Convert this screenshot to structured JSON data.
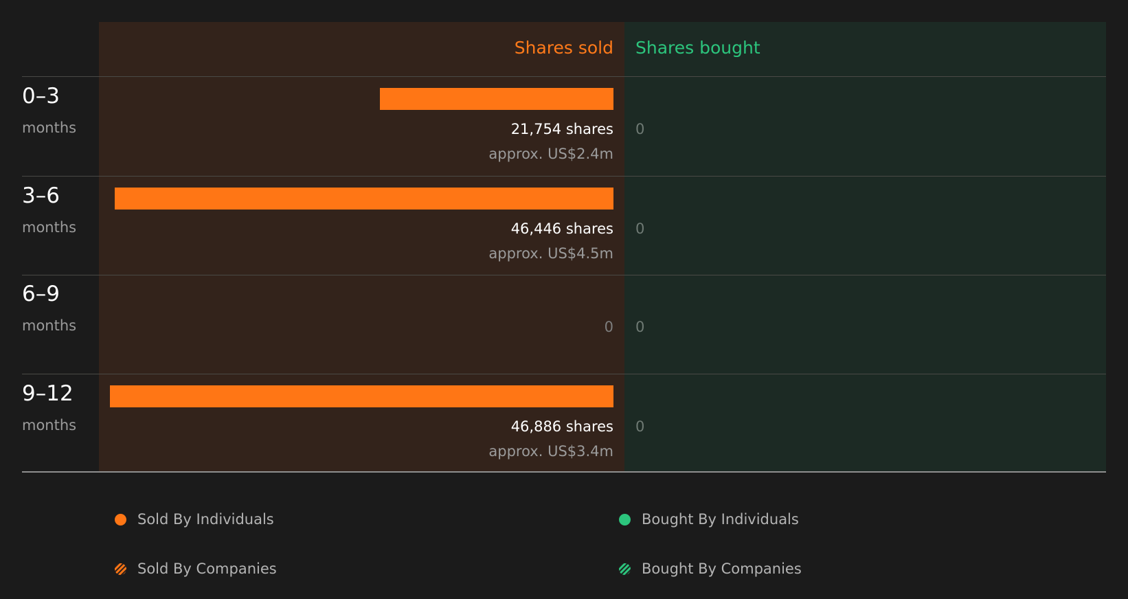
{
  "header": {
    "sold_label": "Shares sold",
    "bought_label": "Shares bought"
  },
  "colors": {
    "sold": "#ff7615",
    "bought": "#2cc57d",
    "sold_panel": "#33231b",
    "bought_panel": "#1c2a24",
    "background": "#1b1b1b"
  },
  "rows": [
    {
      "period": "0–3",
      "unit": "months",
      "sold_shares_text": "21,754 shares",
      "sold_value_text": "approx. US$2.4m",
      "sold_zero_text": "",
      "bought_text": "0"
    },
    {
      "period": "3–6",
      "unit": "months",
      "sold_shares_text": "46,446 shares",
      "sold_value_text": "approx. US$4.5m",
      "sold_zero_text": "",
      "bought_text": "0"
    },
    {
      "period": "6–9",
      "unit": "months",
      "sold_shares_text": "",
      "sold_value_text": "",
      "sold_zero_text": "0",
      "bought_text": "0"
    },
    {
      "period": "9–12",
      "unit": "months",
      "sold_shares_text": "46,886 shares",
      "sold_value_text": "approx. US$3.4m",
      "sold_zero_text": "",
      "bought_text": "0"
    }
  ],
  "legend": {
    "sold_individuals": "Sold By Individuals",
    "bought_individuals": "Bought By Individuals",
    "sold_companies": "Sold By Companies",
    "bought_companies": "Bought By Companies"
  },
  "chart_data": {
    "type": "bar",
    "orientation": "horizontal-diverging",
    "categories": [
      "0–3 months",
      "3–6 months",
      "6–9 months",
      "9–12 months"
    ],
    "series": [
      {
        "name": "Shares sold",
        "values": [
          21754,
          46446,
          0,
          46886
        ]
      },
      {
        "name": "Shares bought",
        "values": [
          0,
          0,
          0,
          0
        ]
      }
    ],
    "sold_value_usd_m": [
      2.4,
      4.5,
      0,
      3.4
    ],
    "legend_placement": "bottom",
    "legend_entries": [
      "Sold By Individuals",
      "Bought By Individuals",
      "Sold By Companies",
      "Bought By Companies"
    ],
    "grid": false
  }
}
